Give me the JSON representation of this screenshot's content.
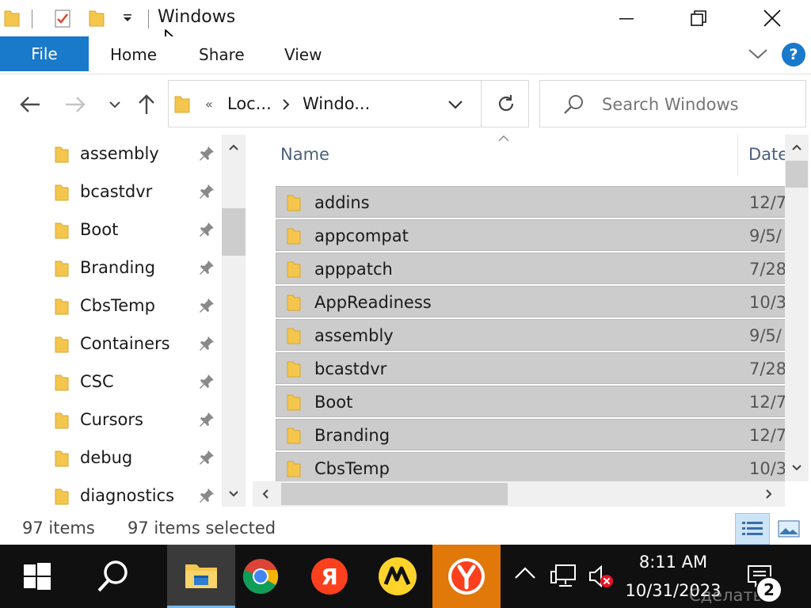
{
  "window": {
    "title": "Windows"
  },
  "ribbon": {
    "tabs": [
      "File",
      "Home",
      "Share",
      "View"
    ],
    "help": "?"
  },
  "address": {
    "prefix": "«",
    "segments": [
      "Loc...",
      "Windo..."
    ]
  },
  "search": {
    "placeholder": "Search Windows"
  },
  "nav_pane": {
    "items": [
      {
        "label": "assembly",
        "pinned": true
      },
      {
        "label": "bcastdvr",
        "pinned": true
      },
      {
        "label": "Boot",
        "pinned": true
      },
      {
        "label": "Branding",
        "pinned": true
      },
      {
        "label": "CbsTemp",
        "pinned": true
      },
      {
        "label": "Containers",
        "pinned": true
      },
      {
        "label": "CSC",
        "pinned": true
      },
      {
        "label": "Cursors",
        "pinned": true
      },
      {
        "label": "debug",
        "pinned": true
      },
      {
        "label": "diagnostics",
        "pinned": true
      }
    ]
  },
  "file_list": {
    "columns": [
      "Name",
      "Date"
    ],
    "rows": [
      {
        "name": "addins",
        "date": "12/7"
      },
      {
        "name": "appcompat",
        "date": "9/5/"
      },
      {
        "name": "apppatch",
        "date": "7/28"
      },
      {
        "name": "AppReadiness",
        "date": "10/3"
      },
      {
        "name": "assembly",
        "date": "9/5/"
      },
      {
        "name": "bcastdvr",
        "date": "7/28"
      },
      {
        "name": "Boot",
        "date": "12/7"
      },
      {
        "name": "Branding",
        "date": "12/7"
      },
      {
        "name": "CbsTemp",
        "date": "10/3"
      }
    ]
  },
  "status": {
    "item_count": "97 items",
    "selected": "97 items selected"
  },
  "taskbar": {
    "apps": [
      "file-explorer",
      "chrome",
      "yandex",
      "yandex-market",
      "yandex-browser"
    ],
    "time": "8:11 AM",
    "date": "10/31/2023",
    "notifications": "2",
    "watermark": "Сделать"
  },
  "colors": {
    "accent": "#1979ca",
    "selection": "#cccccc",
    "folder": "#f4c64e",
    "taskbar": "#101010"
  }
}
